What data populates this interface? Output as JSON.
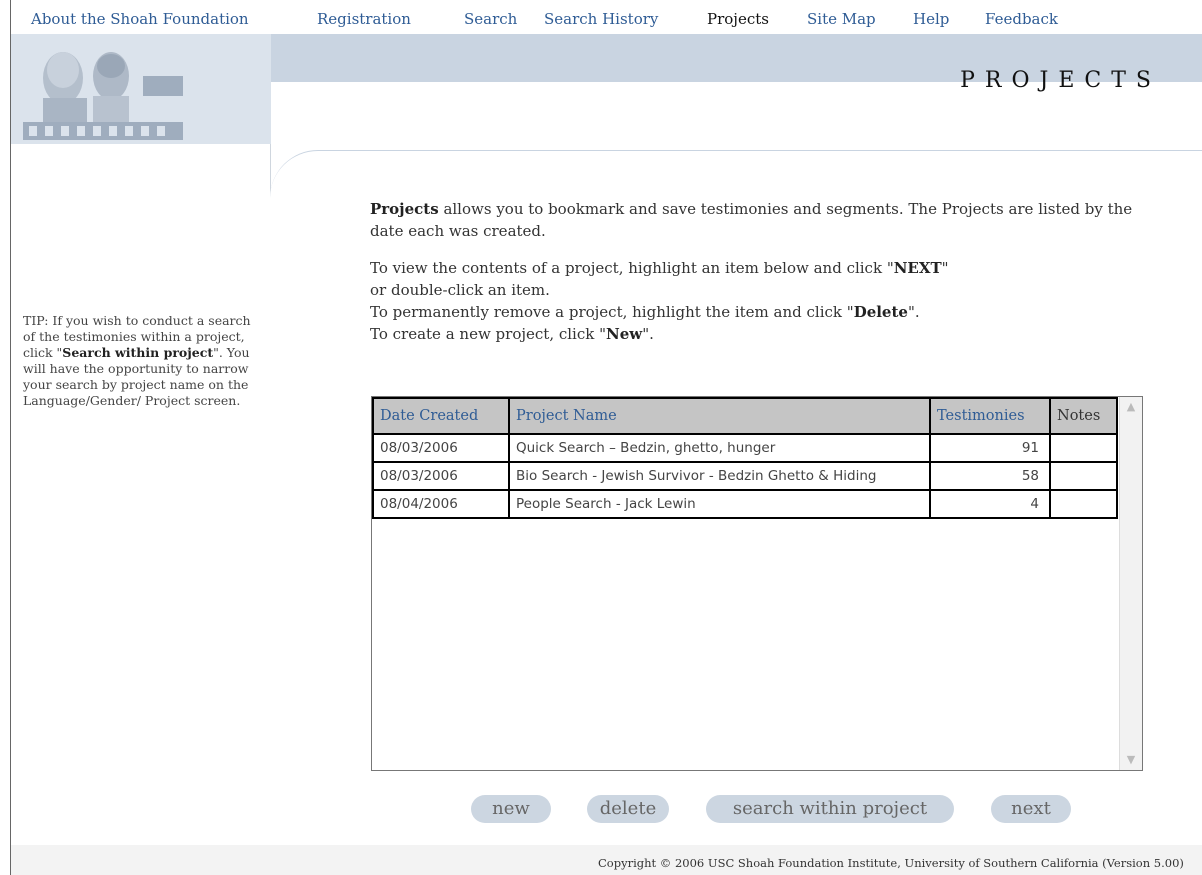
{
  "nav": {
    "items": [
      {
        "label": "About the Shoah Foundation"
      },
      {
        "label": "Registration"
      },
      {
        "label": "Search"
      },
      {
        "label": "Search History"
      },
      {
        "label": "Projects"
      },
      {
        "label": "Site Map"
      },
      {
        "label": "Help"
      },
      {
        "label": "Feedback"
      }
    ]
  },
  "header": {
    "title": "PROJECTS"
  },
  "sidebar": {
    "tip_pre": "TIP: If you wish to conduct a search of the testimonies within a project, click \"",
    "tip_bold": "Search within project",
    "tip_post": "\". You will have the opportunity to narrow your search by project name on the Language/Gender/ Project screen."
  },
  "intro": {
    "p1_bold": "Projects",
    "p1_rest": " allows you to bookmark and save testimonies and segments. The Projects are listed by the date each was created.",
    "line1_pre": "To view the contents of a project, highlight an item below and click \"",
    "line1_bold": "NEXT",
    "line1_post": "\"",
    "line2": "or double-click an item.",
    "line3_pre": "To permanently remove a project, highlight the item and click \"",
    "line3_bold": "Delete",
    "line3_post": "\".",
    "line4_pre": "To create a new project, click \"",
    "line4_bold": "New",
    "line4_post": "\"."
  },
  "table": {
    "headers": {
      "date": "Date Created",
      "name": "Project Name",
      "testimonies": "Testimonies",
      "notes": "Notes"
    },
    "rows": [
      {
        "date": "08/03/2006",
        "name": "Quick Search – Bedzin, ghetto, hunger",
        "testimonies": "91",
        "notes": ""
      },
      {
        "date": "08/03/2006",
        "name": "Bio Search - Jewish Survivor - Bedzin Ghetto & Hiding",
        "testimonies": "58",
        "notes": ""
      },
      {
        "date": "08/04/2006",
        "name": "People Search - Jack Lewin",
        "testimonies": "4",
        "notes": ""
      }
    ]
  },
  "buttons": {
    "new": "new",
    "delete": "delete",
    "search_within": "search within project",
    "next": "next"
  },
  "footer": {
    "copyright": "Copyright © 2006 USC Shoah Foundation Institute, University of Southern California (Version 5.00)"
  },
  "colors": {
    "nav_link": "#2f5c95",
    "header_band": "#c9d4e1",
    "button_bg": "#ccd6e1",
    "table_header_bg": "#c5c5c5"
  }
}
